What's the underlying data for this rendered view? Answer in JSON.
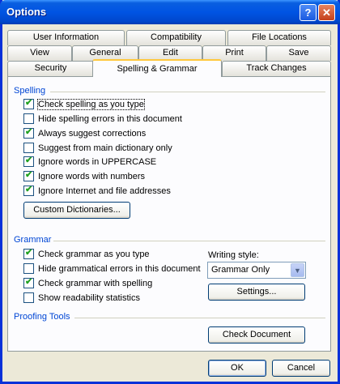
{
  "window": {
    "title": "Options"
  },
  "titlebar": {
    "help_glyph": "?",
    "close_glyph": "✕"
  },
  "tabs": {
    "row1": [
      "User Information",
      "Compatibility",
      "File Locations"
    ],
    "row2": [
      "View",
      "General",
      "Edit",
      "Print",
      "Save"
    ],
    "row3": [
      "Security",
      "Spelling & Grammar",
      "Track Changes"
    ],
    "active": "Spelling & Grammar"
  },
  "spelling": {
    "heading": "Spelling",
    "options": [
      {
        "label": "Check spelling as you type",
        "checked": true
      },
      {
        "label": "Hide spelling errors in this document",
        "checked": false
      },
      {
        "label": "Always suggest corrections",
        "checked": true
      },
      {
        "label": "Suggest from main dictionary only",
        "checked": false
      },
      {
        "label": "Ignore words in UPPERCASE",
        "checked": true
      },
      {
        "label": "Ignore words with numbers",
        "checked": true
      },
      {
        "label": "Ignore Internet and file addresses",
        "checked": true
      }
    ],
    "custom_dictionaries_label": "Custom Dictionaries..."
  },
  "grammar": {
    "heading": "Grammar",
    "options": [
      {
        "label": "Check grammar as you type",
        "checked": true
      },
      {
        "label": "Hide grammatical errors in this document",
        "checked": false
      },
      {
        "label": "Check grammar with spelling",
        "checked": true
      },
      {
        "label": "Show readability statistics",
        "checked": false
      }
    ],
    "writing_style_label": "Writing style:",
    "writing_style_value": "Grammar Only",
    "settings_label": "Settings..."
  },
  "proofing": {
    "heading": "Proofing Tools",
    "check_document_label": "Check Document"
  },
  "footer": {
    "ok_label": "OK",
    "cancel_label": "Cancel"
  }
}
